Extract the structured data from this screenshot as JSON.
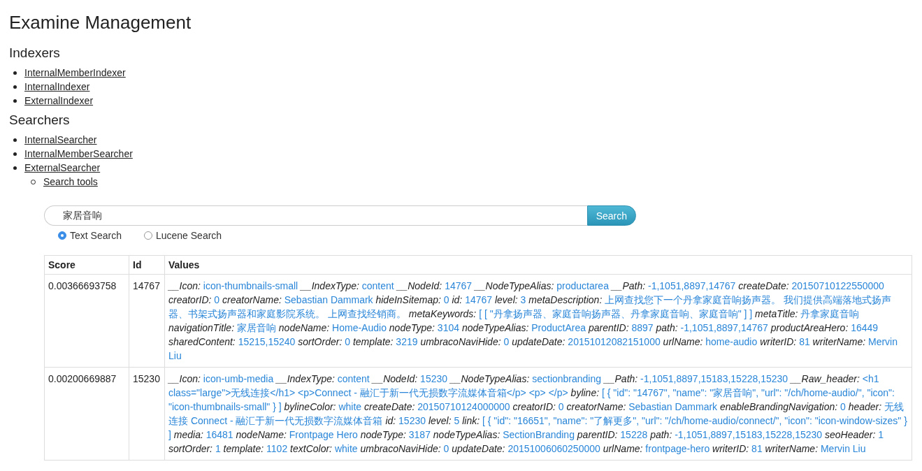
{
  "title": "Examine Management",
  "sections": [
    {
      "heading": "Indexers",
      "items": [
        {
          "label": "InternalMemberIndexer"
        },
        {
          "label": "InternalIndexer"
        },
        {
          "label": "ExternalIndexer"
        }
      ]
    },
    {
      "heading": "Searchers",
      "items": [
        {
          "label": "InternalSearcher"
        },
        {
          "label": "InternalMemberSearcher"
        },
        {
          "label": "ExternalSearcher",
          "children": [
            {
              "label": "Search tools"
            }
          ]
        }
      ]
    }
  ],
  "search": {
    "value": "家居音响",
    "button": "Search",
    "modes": [
      {
        "label": "Text Search",
        "selected": true
      },
      {
        "label": "Lucene Search",
        "selected": false
      }
    ]
  },
  "table": {
    "columns": [
      "Score",
      "Id",
      "Values"
    ],
    "rows": [
      {
        "score": "0.00366693758",
        "id": "14767",
        "values": [
          {
            "key": "__Icon:",
            "value": "icon-thumbnails-small"
          },
          {
            "key": "__IndexType:",
            "value": "content"
          },
          {
            "key": "__NodeId:",
            "value": "14767"
          },
          {
            "key": "__NodeTypeAlias:",
            "value": "productarea"
          },
          {
            "key": "__Path:",
            "value": "-1,1051,8897,14767"
          },
          {
            "key": "createDate:",
            "value": "20150710122550000"
          },
          {
            "key": "creatorID:",
            "value": "0"
          },
          {
            "key": "creatorName:",
            "value": "Sebastian Dammark"
          },
          {
            "key": "hideInSitemap:",
            "value": "0"
          },
          {
            "key": "id:",
            "value": "14767"
          },
          {
            "key": "level:",
            "value": "3"
          },
          {
            "key": "metaDescription:",
            "value": "上网查找您下一个丹拿家庭音响扬声器。 我们提供高端落地式扬声器、书架式扬声器和家庭影院系统。 上网查找经销商。"
          },
          {
            "key": "metaKeywords:",
            "value": "[ [ \"丹拿扬声器、家庭音响扬声器、丹拿家庭音响、家庭音响\" ] ]"
          },
          {
            "key": "metaTitle:",
            "value": "丹拿家庭音响"
          },
          {
            "key": "navigationTitle:",
            "value": "家居音响"
          },
          {
            "key": "nodeName:",
            "value": "Home-Audio"
          },
          {
            "key": "nodeType:",
            "value": "3104"
          },
          {
            "key": "nodeTypeAlias:",
            "value": "ProductArea"
          },
          {
            "key": "parentID:",
            "value": "8897"
          },
          {
            "key": "path:",
            "value": "-1,1051,8897,14767"
          },
          {
            "key": "productAreaHero:",
            "value": "16449"
          },
          {
            "key": "sharedContent:",
            "value": "15215,15240"
          },
          {
            "key": "sortOrder:",
            "value": "0"
          },
          {
            "key": "template:",
            "value": "3219"
          },
          {
            "key": "umbracoNaviHide:",
            "value": "0"
          },
          {
            "key": "updateDate:",
            "value": "20151012082151000"
          },
          {
            "key": "urlName:",
            "value": "home-audio"
          },
          {
            "key": "writerID:",
            "value": "81"
          },
          {
            "key": "writerName:",
            "value": "Mervin Liu"
          }
        ]
      },
      {
        "score": "0.00200669887",
        "id": "15230",
        "values": [
          {
            "key": "__Icon:",
            "value": "icon-umb-media"
          },
          {
            "key": "__IndexType:",
            "value": "content"
          },
          {
            "key": "__NodeId:",
            "value": "15230"
          },
          {
            "key": "__NodeTypeAlias:",
            "value": "sectionbranding"
          },
          {
            "key": "__Path:",
            "value": "-1,1051,8897,15183,15228,15230"
          },
          {
            "key": "__Raw_header:",
            "value": "<h1 class=\"large\">无线连接</h1> <p>Connect - 融汇于新一代无损数字流媒体音箱</p> <p> </p>"
          },
          {
            "key": "byline:",
            "value": "[ { \"id\": \"14767\", \"name\": \"家居音响\", \"url\": \"/ch/home-audio/\", \"icon\": \"icon-thumbnails-small\" } ]"
          },
          {
            "key": "bylineColor:",
            "value": "white"
          },
          {
            "key": "createDate:",
            "value": "20150710124000000"
          },
          {
            "key": "creatorID:",
            "value": "0"
          },
          {
            "key": "creatorName:",
            "value": "Sebastian Dammark"
          },
          {
            "key": "enableBrandingNavigation:",
            "value": "0"
          },
          {
            "key": "header:",
            "value": "无线连接 Connect - 融汇于新一代无损数字流媒体音箱"
          },
          {
            "key": "id:",
            "value": "15230"
          },
          {
            "key": "level:",
            "value": "5"
          },
          {
            "key": "link:",
            "value": "[ { \"id\": \"16651\", \"name\": \"了解更多\", \"url\": \"/ch/home-audio/connect/\", \"icon\": \"icon-window-sizes\" } ]"
          },
          {
            "key": "media:",
            "value": "16481"
          },
          {
            "key": "nodeName:",
            "value": "Frontpage Hero"
          },
          {
            "key": "nodeType:",
            "value": "3187"
          },
          {
            "key": "nodeTypeAlias:",
            "value": "SectionBranding"
          },
          {
            "key": "parentID:",
            "value": "15228"
          },
          {
            "key": "path:",
            "value": "-1,1051,8897,15183,15228,15230"
          },
          {
            "key": "seoHeader:",
            "value": "1"
          },
          {
            "key": "sortOrder:",
            "value": "1"
          },
          {
            "key": "template:",
            "value": "1102"
          },
          {
            "key": "textColor:",
            "value": "white"
          },
          {
            "key": "umbracoNaviHide:",
            "value": "0"
          },
          {
            "key": "updateDate:",
            "value": "20151006060250000"
          },
          {
            "key": "urlName:",
            "value": "frontpage-hero"
          },
          {
            "key": "writerID:",
            "value": "81"
          },
          {
            "key": "writerName:",
            "value": "Mervin Liu"
          }
        ]
      }
    ]
  }
}
